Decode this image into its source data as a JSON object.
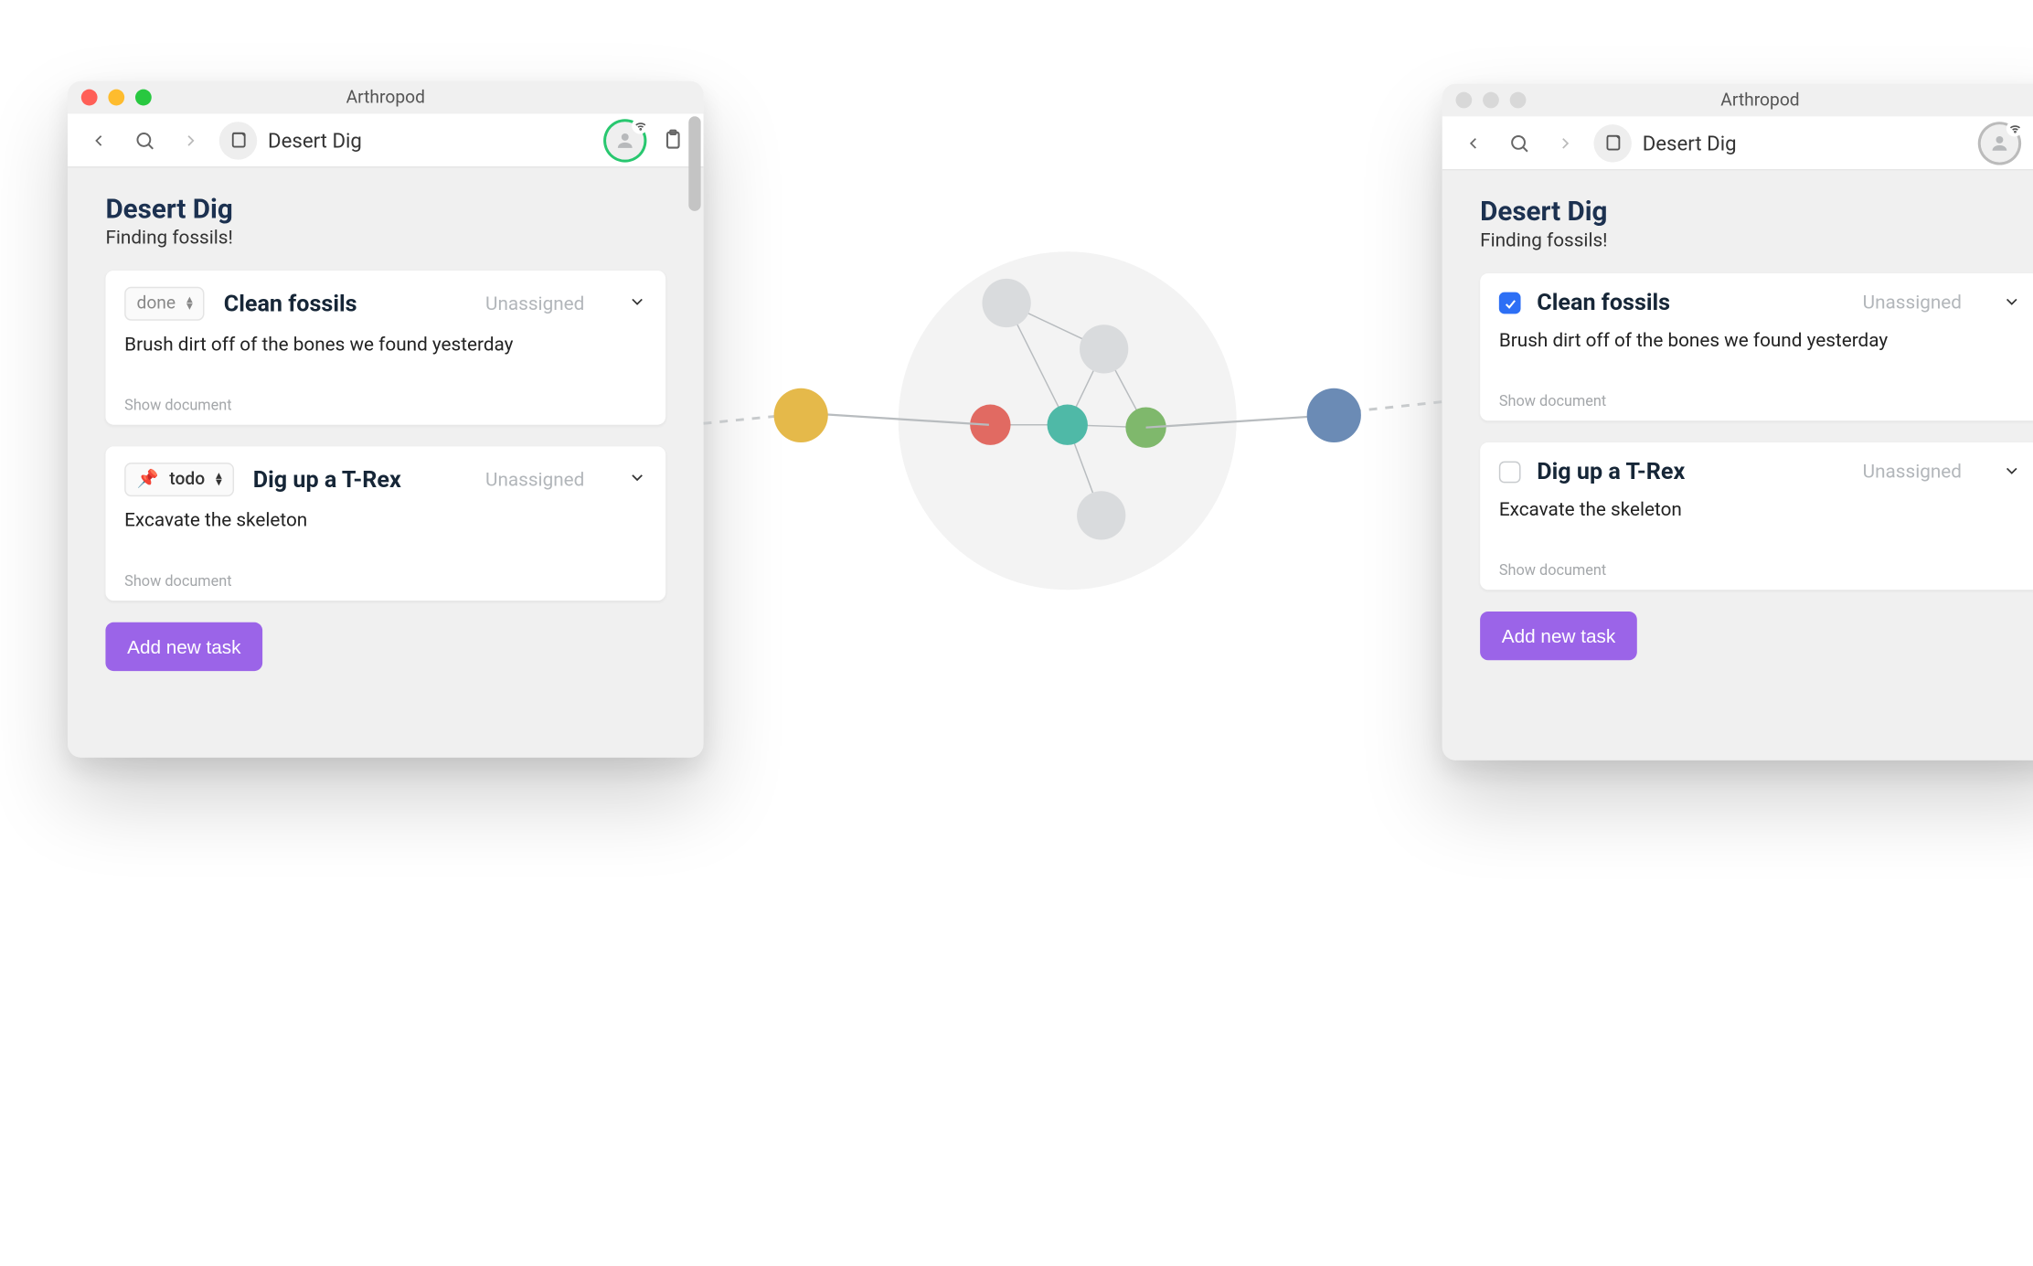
{
  "app_name": "Arthropod",
  "windows": {
    "left": {
      "breadcrumb": "Desert Dig",
      "project_title": "Desert Dig",
      "project_subtitle": "Finding fossils!",
      "tasks": [
        {
          "status_label": "done",
          "title": "Clean fossils",
          "assignment": "Unassigned",
          "description": "Brush dirt off of the bones we found yesterday",
          "footer": "Show document"
        },
        {
          "status_label": "todo",
          "pinned": true,
          "title": "Dig up a T-Rex",
          "assignment": "Unassigned",
          "description": "Excavate the skeleton",
          "footer": "Show document"
        }
      ],
      "add_button": "Add new task"
    },
    "right": {
      "breadcrumb": "Desert Dig",
      "project_title": "Desert Dig",
      "project_subtitle": "Finding fossils!",
      "tasks": [
        {
          "checked": true,
          "title": "Clean fossils",
          "assignment": "Unassigned",
          "description": "Brush dirt off of the bones we found yesterday",
          "footer": "Show document"
        },
        {
          "checked": false,
          "title": "Dig up a T-Rex",
          "assignment": "Unassigned",
          "description": "Excavate the skeleton",
          "footer": "Show document"
        }
      ],
      "add_button": "Add new task"
    }
  }
}
